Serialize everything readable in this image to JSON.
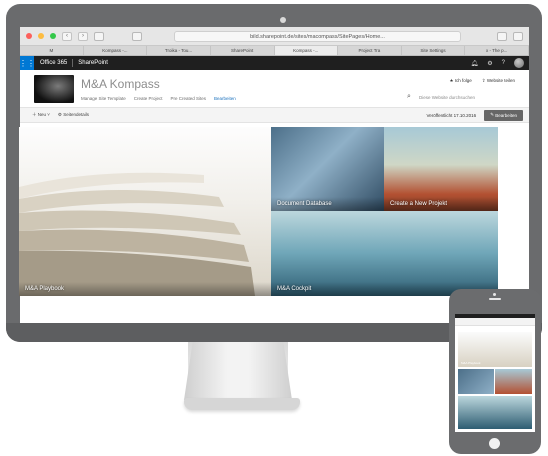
{
  "browser": {
    "address": "bild.sharepoint.de/sites/macompass/SitePages/Home...",
    "tabs": [
      "M",
      "Kompass -...",
      "Troika - Tou...",
      "SharePoint",
      "Kompass -...",
      "Project Tra",
      "Site Settings",
      "x - The p..."
    ],
    "active_tab_index": 4
  },
  "suite": {
    "app_name": "Office 365",
    "product": "SharePoint"
  },
  "site": {
    "title": "M&A Kompass",
    "nav": [
      "Manage Site Template",
      "Create Project",
      "Pre Created Sites",
      "Bearbeiten"
    ],
    "follow_label": "Ich folge",
    "share_label": "Website teilen",
    "search_placeholder": "Diese Website durchsuchen"
  },
  "commandbar": {
    "new_label": "Neu",
    "details_label": "Seitendetails",
    "saved_label": "Veröffentlicht 17.10.2016",
    "edit_label": "Bearbeiten"
  },
  "tiles": {
    "playbook": "M&A Playbook",
    "document_db": "Document Database",
    "new_project": "Create a New Projekt",
    "cockpit": "M&A Cockpit"
  },
  "phone": {
    "playbook_caption": "M&A Playbook"
  }
}
